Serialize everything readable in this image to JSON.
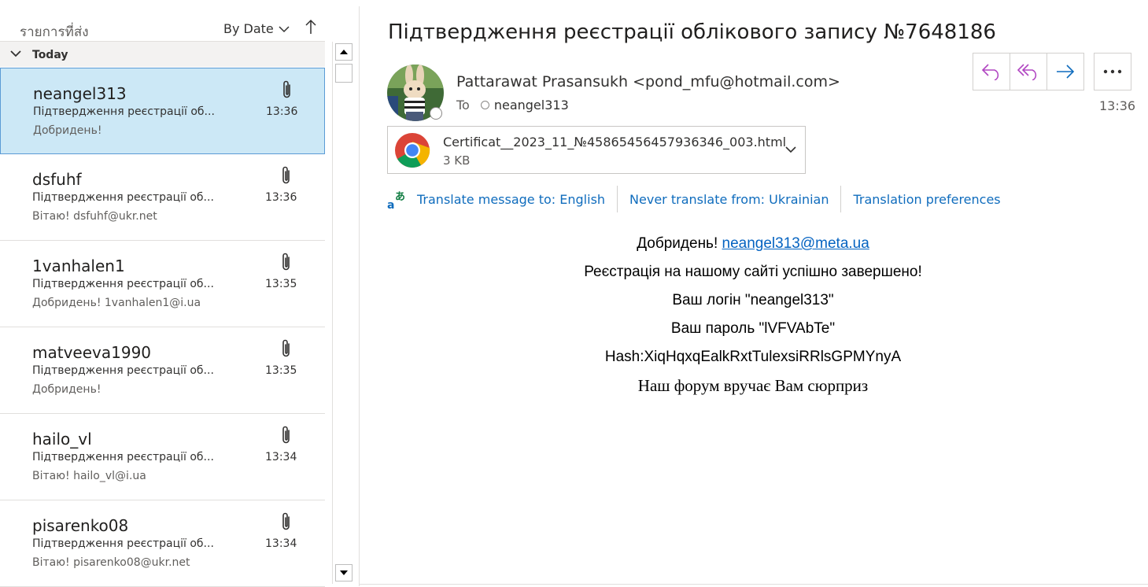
{
  "list": {
    "folder_name": "รายการที่ส่ง",
    "sort_label": "By Date",
    "sort_direction_icon": "up-arrow",
    "group_label": "Today",
    "messages": [
      {
        "sender": "neangel313",
        "subject": "Підтвердження реєстрації об...",
        "preview": "Добридень!",
        "time": "13:36",
        "selected": true
      },
      {
        "sender": "dsfuhf",
        "subject": "Підтвердження реєстрації об...",
        "preview": "Вітаю! dsfuhf@ukr.net",
        "time": "13:36"
      },
      {
        "sender": "1vanhalen1",
        "subject": "Підтвердження реєстрації об...",
        "preview": "Добридень! 1vanhalen1@i.ua",
        "time": "13:35"
      },
      {
        "sender": "matveeva1990",
        "subject": "Підтвердження реєстрації об...",
        "preview": "Добридень!",
        "time": "13:35"
      },
      {
        "sender": "hailo_vl",
        "subject": "Підтвердження реєстрації об...",
        "preview": "Вітаю! hailo_vl@i.ua",
        "time": "13:34"
      },
      {
        "sender": "pisarenko08",
        "subject": "Підтвердження реєстрації об...",
        "preview": "Вітаю! pisarenko08@ukr.net",
        "time": "13:34"
      }
    ]
  },
  "reading": {
    "subject": "Підтвердження реєстрації облікового запису №7648186",
    "from": "Pattarawat Prasansukh <pond_mfu@hotmail.com>",
    "to_label": "To",
    "to": "neangel313",
    "time": "13:36",
    "attachment": {
      "name": "Certificat__2023_11_№458654564579363​46_003.html",
      "size": "3 KB"
    },
    "translate": {
      "translate_to": "Translate message to: English",
      "never_translate": "Never translate from: Ukrainian",
      "preferences": "Translation preferences"
    },
    "body": {
      "greeting": "Добридень!",
      "greeting_email": "neangel313@meta.ua",
      "line2": "Реєстрація на нашому сайті успішно завершено!",
      "line3": "Ваш логін \"neangel313\"",
      "line4": "Ваш пароль \"lVFVAbTe\"",
      "line5": "Hash:XiqHqxqEalkRxtTulexsiRRlsGPMYnyA",
      "line6": "Наш форум вручає Вам сюрприз"
    }
  },
  "colors": {
    "accent": "#0f6cbd",
    "action_icon": "#b146c2",
    "selected_bg": "#cce8f6",
    "selected_border": "#5b9bd5"
  }
}
